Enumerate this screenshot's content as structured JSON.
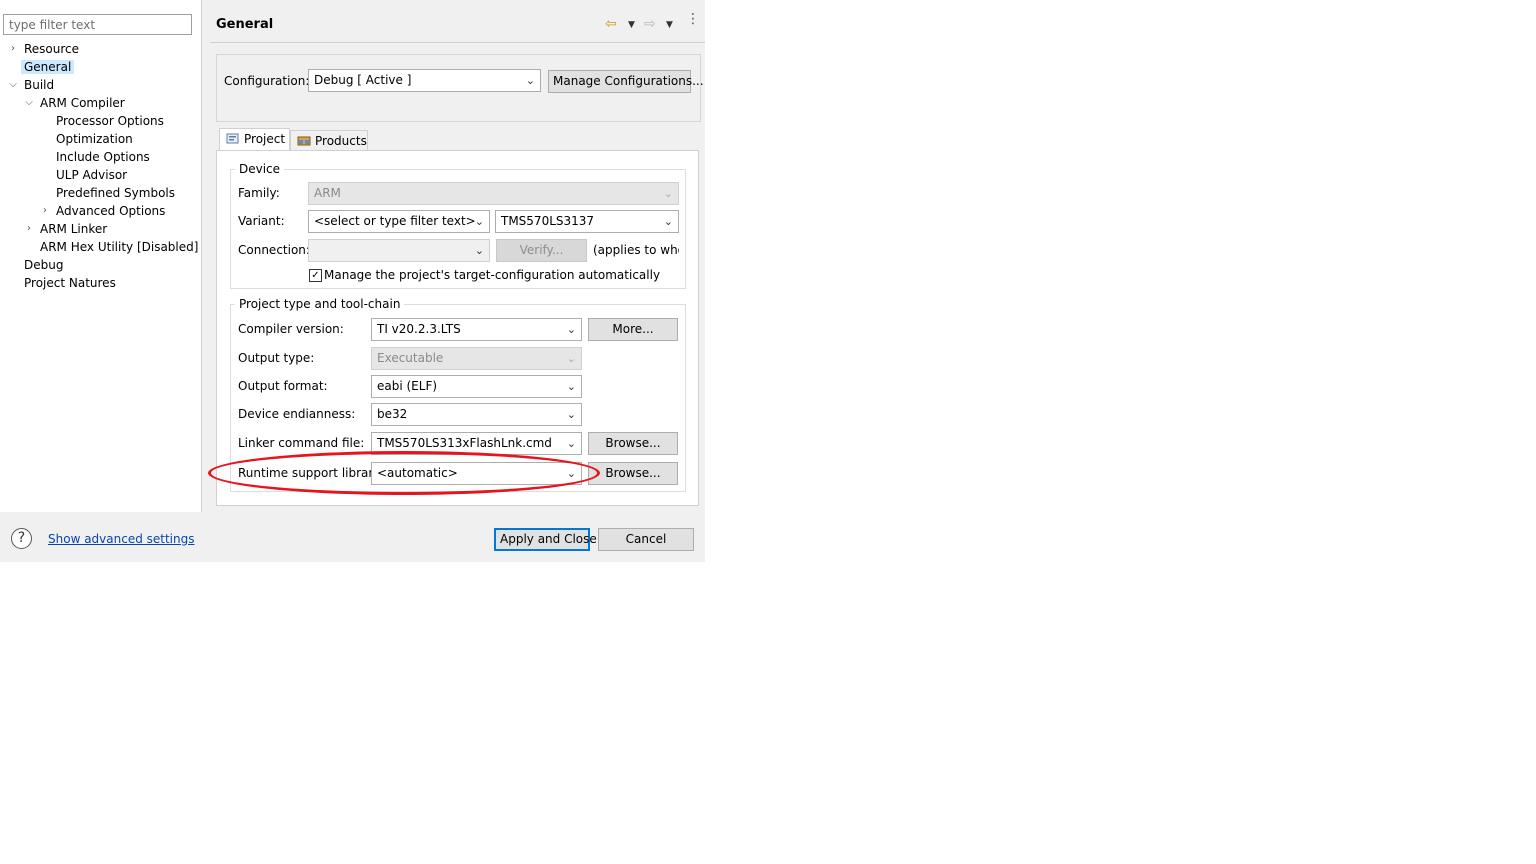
{
  "filter": {
    "placeholder": "type filter text"
  },
  "tree": {
    "resource": "Resource",
    "general": "General",
    "build": "Build",
    "arm_compiler": "ARM Compiler",
    "processor_options": "Processor Options",
    "optimization": "Optimization",
    "include_options": "Include Options",
    "ulp_advisor": "ULP Advisor",
    "predefined_symbols": "Predefined Symbols",
    "advanced_options": "Advanced Options",
    "arm_linker": "ARM Linker",
    "arm_hex_utility": "ARM Hex Utility  [Disabled]",
    "debug": "Debug",
    "project_natures": "Project Natures"
  },
  "page": {
    "title": "General"
  },
  "configuration": {
    "label": "Configuration:",
    "value": "Debug  [ Active ]",
    "manage_button": "Manage Configurations..."
  },
  "tabs": {
    "project": "Project",
    "products": "Products"
  },
  "device": {
    "title": "Device",
    "family_label": "Family:",
    "family_value": "ARM",
    "variant_label": "Variant:",
    "variant_filter": "<select or type filter text>",
    "variant_value": "TMS570LS3137",
    "connection_label": "Connection:",
    "connection_value": "",
    "verify_button": "Verify...",
    "applies_text": "(applies to whole",
    "manage_checkbox": "Manage the project's target-configuration automatically",
    "manage_checked": true
  },
  "toolchain": {
    "title": "Project type and tool-chain",
    "compiler_label": "Compiler version:",
    "compiler_value": "TI v20.2.3.LTS",
    "more_button": "More...",
    "output_type_label": "Output type:",
    "output_type_value": "Executable",
    "output_format_label": "Output format:",
    "output_format_value": "eabi (ELF)",
    "endianness_label": "Device endianness:",
    "endianness_value": "be32",
    "linker_label": "Linker command file:",
    "linker_value": "TMS570LS313xFlashLnk.cmd",
    "browse_button": "Browse...",
    "rts_label": "Runtime support library:",
    "rts_value": "<automatic>",
    "browse_button_2": "Browse..."
  },
  "footer": {
    "help_symbol": "?",
    "advanced_link": "Show advanced settings",
    "apply_button": "Apply and Close",
    "cancel_button": "Cancel"
  },
  "colors": {
    "highlight": "#e8141d",
    "selection": "#cce8ff",
    "link": "#0645ad"
  }
}
